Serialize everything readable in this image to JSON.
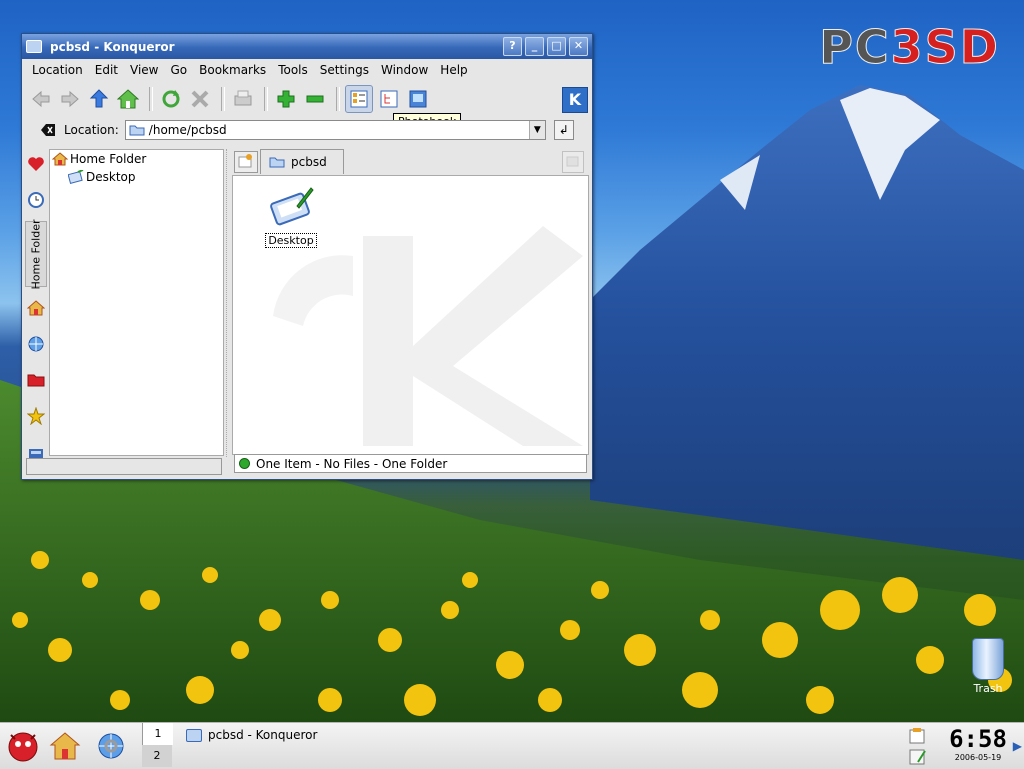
{
  "desktop": {
    "logo": {
      "pc": "PC",
      "bsd": "3SD"
    },
    "trash_label": "Trash"
  },
  "window": {
    "title": "pcbsd - Konqueror",
    "buttons": {
      "help": "?",
      "minimize": "_",
      "maximize": "□",
      "close": "✕"
    }
  },
  "menubar": [
    "Location",
    "Edit",
    "View",
    "Go",
    "Bookmarks",
    "Tools",
    "Settings",
    "Window",
    "Help"
  ],
  "toolbar": {
    "tooltip": "Photobook"
  },
  "location": {
    "label": "Location:",
    "value": "/home/pcbsd"
  },
  "tree": {
    "items": [
      "Home Folder",
      "Desktop"
    ]
  },
  "sidebar": {
    "home_tab": "Home Folder"
  },
  "tabs": {
    "current": "pcbsd"
  },
  "files": [
    {
      "name": "Desktop"
    }
  ],
  "status": "One Item - No Files - One Folder",
  "taskbar": {
    "pager": [
      "1",
      "2"
    ],
    "task": "pcbsd - Konqueror",
    "clock_time": "6:58",
    "clock_date": "2006-05-19"
  },
  "colors": {
    "title_blue": "#3668b8",
    "logo_red": "#d61f1f",
    "status_green": "#2da82d"
  }
}
